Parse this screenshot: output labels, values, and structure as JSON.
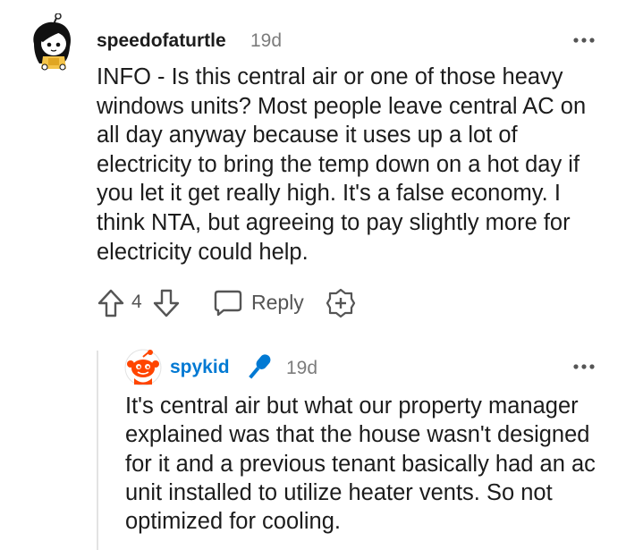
{
  "comment": {
    "username": "speedofaturtle",
    "timestamp": "19d",
    "text": "INFO - Is this central air or one of those heavy windows units? Most people leave central AC on all day anyway because it uses up a lot of electricity to bring the temp down on a hot day if you let it get really high. It's a false economy. I think NTA, but agreeing to pay slightly more for electricity could help.",
    "score": "4",
    "reply_label": "Reply",
    "avatar_icon": "user-avatar-icon",
    "more_icon": "more-options-icon"
  },
  "reply": {
    "username": "spykid",
    "timestamp": "19d",
    "text": "It's central air but what our property manager explained was that the house wasn't designed for it and a previous tenant basically had an ac unit installed to utilize heater vents. So not optimized for cooling.",
    "username_color": "#0079d3",
    "flair_icon": "microphone-icon",
    "avatar_icon": "snoo-avatar-icon"
  },
  "icons": {
    "upvote": "upvote-arrow-icon",
    "downvote": "downvote-arrow-icon",
    "reply": "speech-bubble-icon",
    "award": "plus-award-icon"
  }
}
